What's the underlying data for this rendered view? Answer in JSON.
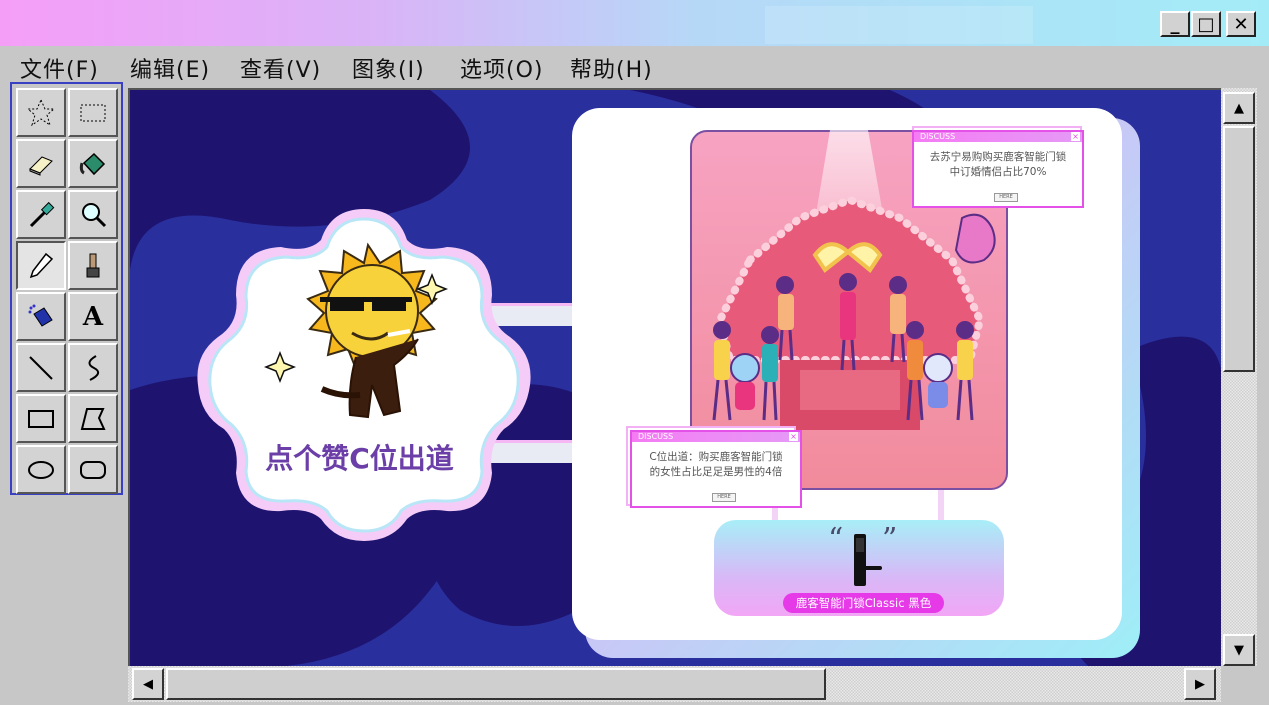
{
  "window": {
    "controls": {
      "minimize": "_",
      "maximize": "□",
      "close": "✕"
    }
  },
  "menu": [
    {
      "label": "文件(F)"
    },
    {
      "label": "编辑(E)"
    },
    {
      "label": "查看(V)"
    },
    {
      "label": "图象(I)"
    },
    {
      "label": "选项(O)"
    },
    {
      "label": "帮助(H)"
    }
  ],
  "toolbox": {
    "tools": [
      {
        "icon": "free-select-icon"
      },
      {
        "icon": "rect-select-icon"
      },
      {
        "icon": "eraser-icon"
      },
      {
        "icon": "fill-bucket-icon"
      },
      {
        "icon": "color-picker-icon"
      },
      {
        "icon": "magnifier-icon"
      },
      {
        "icon": "pencil-icon"
      },
      {
        "icon": "brush-icon"
      },
      {
        "icon": "airbrush-icon"
      },
      {
        "icon": "text-icon",
        "glyph": "A"
      },
      {
        "icon": "line-icon"
      },
      {
        "icon": "curve-icon"
      },
      {
        "icon": "rectangle-icon"
      },
      {
        "icon": "polygon-icon"
      },
      {
        "icon": "ellipse-icon"
      },
      {
        "icon": "rounded-rect-icon"
      }
    ],
    "active": "pencil-icon"
  },
  "canvas": {
    "badge_text": "点个赞C位出道",
    "popup_top": {
      "header": "DISCUSS",
      "line1": "去苏宁易购购买鹿客智能门锁",
      "line2": "中订婚情侣占比70%",
      "button": "HERE"
    },
    "popup_bottom": {
      "header": "DISCUSS",
      "line1": "C位出道：购买鹿客智能门锁",
      "line2": "的女性占比足足是男性的4倍",
      "button": "HERE"
    },
    "quote_open": "“",
    "quote_close": "”",
    "product_label": "鹿客智能门锁Classic 黑色"
  },
  "colors": {
    "canvas_bg": "#2a2f9e",
    "blob_dark": "#1e1470",
    "accent_pink": "#e63ae8",
    "accent_cyan": "#9df0f6",
    "badge_text": "#6b3fa7"
  },
  "scrollbars": {
    "up": "▲",
    "down": "▼",
    "left": "◀",
    "right": "▶"
  }
}
